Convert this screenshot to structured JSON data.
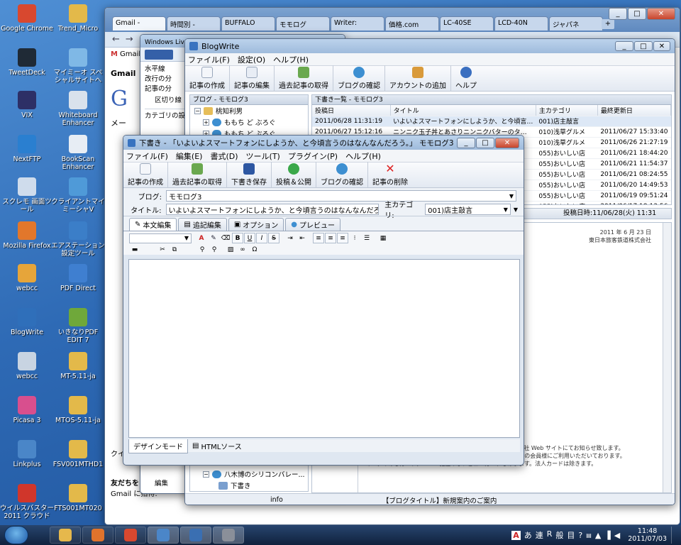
{
  "desktop_icons": [
    {
      "label": "Google Chrome",
      "icon": "chrome-icon",
      "color": "#d8482f"
    },
    {
      "label": "Trend_Micro",
      "icon": "folder-icon",
      "color": "#e3b94a"
    },
    {
      "label": "TweetDeck",
      "icon": "tweetdeck-icon",
      "color": "#1f2a36"
    },
    {
      "label": "マイミーオ スペシャルサイトへ",
      "icon": "shortcut-icon",
      "color": "#7fb8e6"
    },
    {
      "label": "VIX",
      "icon": "vix-icon",
      "color": "#2d2f66"
    },
    {
      "label": "Whiteboard Enhancer",
      "icon": "whiteboard-icon",
      "color": "#d9e2ec"
    },
    {
      "label": "NextFTP",
      "icon": "ftp-icon",
      "color": "#2a7fd0"
    },
    {
      "label": "BookScan Enhancer",
      "icon": "bookscan-icon",
      "color": "#e7edf4"
    },
    {
      "label": "スクレモ 画面ツール",
      "icon": "screen-tool-icon",
      "color": "#cfdcec"
    },
    {
      "label": "クライアントマイミーシャV",
      "icon": "client-icon",
      "color": "#4f9ad8"
    },
    {
      "label": "Mozilla Firefox",
      "icon": "firefox-icon",
      "color": "#e2772b"
    },
    {
      "label": "エアステーション設定ツール",
      "icon": "airstation-icon",
      "color": "#3b7ec8"
    },
    {
      "label": "webcc",
      "icon": "webcc-icon",
      "color": "#e6a53a"
    },
    {
      "label": "PDF Direct",
      "icon": "pdf-direct-icon",
      "color": "#3f7fd0"
    },
    {
      "label": "BlogWrite",
      "icon": "blogwrite-icon",
      "color": "#2f6fba"
    },
    {
      "label": "いきなりPDF EDIT 7",
      "icon": "pdf-edit-icon",
      "color": "#6fa83a"
    },
    {
      "label": "webcc",
      "icon": "webcc-icon",
      "color": "#c8d4e2"
    },
    {
      "label": "MT-5.11-ja",
      "icon": "folder-icon",
      "color": "#e3b94a"
    },
    {
      "label": "Picasa 3",
      "icon": "picasa-icon",
      "color": "#d84f8e"
    },
    {
      "label": "MTOS-5.11-ja",
      "icon": "folder-icon",
      "color": "#e3b94a"
    },
    {
      "label": "Linkplus",
      "icon": "linkplus-icon",
      "color": "#4a86c8"
    },
    {
      "label": "FSV001MTHD1",
      "icon": "folder-icon",
      "color": "#e3b94a"
    },
    {
      "label": "ウイルスバスター 2011 クラウド",
      "icon": "virus-buster-icon",
      "color": "#d0362b"
    },
    {
      "label": "FTS001MT020",
      "icon": "folder-icon",
      "color": "#e3b94a"
    }
  ],
  "browser": {
    "tabs": [
      "Gmail - ",
      "時間別 -",
      "BUFFALO",
      "モモログ",
      "Writer:",
      "価格.com",
      "LC-40SE",
      "LCD-40N",
      "ジャパネ"
    ],
    "gmail_label": "Gmail",
    "gmail_sidebar": [
      "Gmail",
      "メー"
    ],
    "gmail_bottom": [
      "友だちを",
      "Gmail に招待:",
      "クイ"
    ]
  },
  "lw": {
    "title": "Windows Live Writer 2011でBlog Writeに変換して下書きを投稿する - Windows Live Writer",
    "sidebar": [
      "水平線",
      "改行の分",
      "記事の分",
      "区切り線",
      "カテゴリの設定"
    ],
    "bottom_btn": "編集"
  },
  "bw": {
    "title": "BlogWrite",
    "menu": [
      "ファイル(F)",
      "設定(O)",
      "ヘルプ(H)"
    ],
    "toolbar": [
      "記事の作成",
      "記事の編集",
      "過去記事の取得",
      "ブログの確認",
      "アカウントの追加",
      "ヘルプ"
    ],
    "tree_header": "ブログ - モモログ3",
    "tree": [
      "桃知利男",
      "ももち ど ぶろぐ",
      "ももち ど ぶろぐ",
      "八木博のシリコンバレー...",
      "下書き"
    ],
    "list_header": "下書き一覧 - モモログ3",
    "columns": [
      "投稿日",
      "タイトル",
      "主カテゴリ",
      "最終更新日"
    ],
    "rows": [
      [
        "2011/06/28 11:31:19",
        "いよいよスマートフォンにしようか、と今頃言…",
        "001)店主敲言",
        ""
      ],
      [
        "2011/06/27 15:12:16",
        "ニンニク玉子丼とあさりニンニクバターのタ…",
        "010)浅草グルメ",
        "2011/06/27 15:33:40"
      ],
      [
        "",
        "",
        "010)浅草グルメ",
        "2011/06/26 21:27:19"
      ],
      [
        "",
        "",
        "055)おいしい店",
        "2011/06/21 18:44:20"
      ],
      [
        "",
        "",
        "055)おいしい店",
        "2011/06/21 11:54:37"
      ],
      [
        "",
        "",
        "055)おいしい店",
        "2011/06/21 08:24:55"
      ],
      [
        "",
        "",
        "055)おいしい店",
        "2011/06/20 14:49:53"
      ],
      [
        "",
        "",
        "055)おいしい店",
        "2011/06/19 09:51:24"
      ],
      [
        "",
        "",
        "055)おいしい店",
        "2011/06/17 18:13:56"
      ]
    ],
    "post_time": "投稿日時:11/06/28(火) 11:31",
    "preview_lines": [
      "2011 年 6 月 23 日",
      "東日本旅客鉄道株式会社",
      "ォンにおける",
      "ス開始について",
      "株式会社、ソフトバンク",
      "roid™搭載スマートフォ",
      "社長:清野 智、以下 JR 東日",
      "株式会社のおサイフケータイ®対応",
      "1 年 7 月 23 日(土)よりモバイ",
      "しでモバイル Suica アプリの提",
      "けてお知らせ致します。",
      "す。)",
      "社名:Softbank/Disney",
      "機種表示」",
      "、下の定期券",
      "ードスマートフォンで開始します。",
      "超過チャージサービスにつきましては、詳細が決まり次第、弊社 Web サイトにてお知らせ致します。",
      "モバイル Suica サービスは、2011 年 4 月末時点約 240 万人の会員様にご利用いただいております。",
      "マークのあるカード、Suica 機能のないビューカードもあります。法人カードは除きます。"
    ],
    "status_left": "info",
    "status_mid": "【ブログタイトル】新規案内のご案内"
  },
  "editor": {
    "title": "下書き - 「いよいよスマートフォンにしようか、と今頃言うのはなんなんだろう。」 モモログ3",
    "menu": [
      "ファイル(F)",
      "編集(E)",
      "書式(D)",
      "ツール(T)",
      "プラグイン(P)",
      "ヘルプ(H)"
    ],
    "toolbar": [
      "記事の作成",
      "過去記事の取得",
      "下書き保存",
      "投稿＆公開",
      "ブログの確認",
      "記事の削除"
    ],
    "blog_label": "ブログ:",
    "blog_value": "モモログ3",
    "title_label": "タイトル:",
    "title_value": "いよいよスマートフォンにしようか、と今頃言うのはなんなんだろう。",
    "category_label": "主カテゴリ:",
    "category_value": "001)店主敲言",
    "tabs": [
      "本文編集",
      "追記編集",
      "オプション",
      "プレビュー"
    ],
    "format_glyphs": [
      "B",
      "U",
      "I",
      "S"
    ],
    "mode_tabs": [
      "デザインモード",
      "HTMLソース"
    ]
  },
  "taskbar": {
    "pinned": [
      {
        "name": "explorer-icon",
        "color": "#e6b84c"
      },
      {
        "name": "media-player-icon",
        "color": "#e0732c"
      },
      {
        "name": "chrome-icon",
        "color": "#d8482f"
      },
      {
        "name": "live-writer-icon",
        "color": "#4b86c8"
      },
      {
        "name": "blogwrite-icon",
        "color": "#3a6fb2"
      },
      {
        "name": "movie-icon",
        "color": "#8a8f99"
      }
    ],
    "ime": [
      "あ",
      "連",
      "R",
      "般",
      "目"
    ],
    "time": "11:48",
    "date": "2011/07/03"
  }
}
